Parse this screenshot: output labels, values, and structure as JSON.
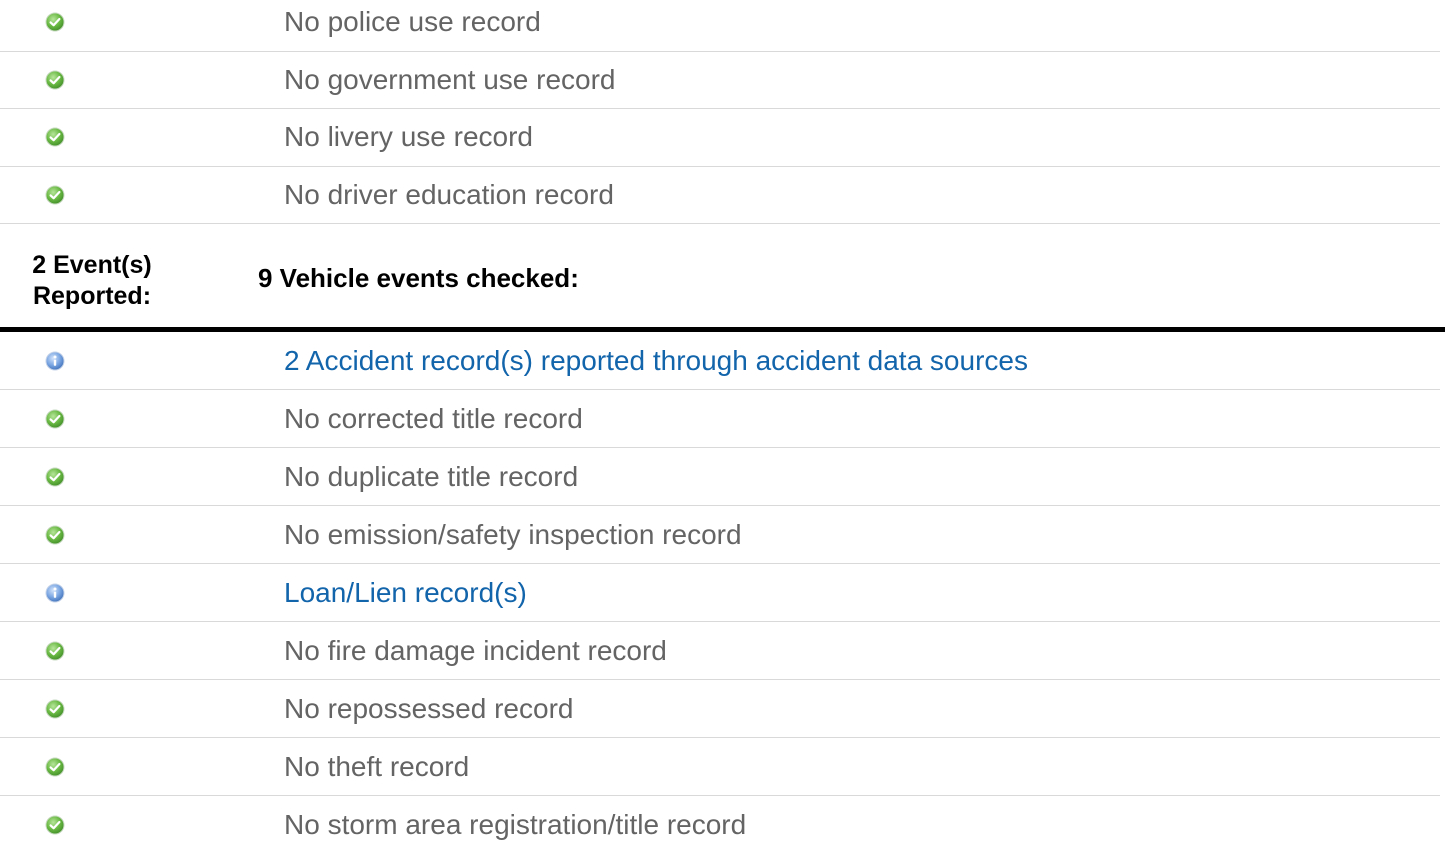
{
  "colors": {
    "ok_green": "#69b943",
    "info_blue": "#5d8fd3",
    "text_gray": "#646464",
    "link_blue": "#1264ab",
    "divider": "#d9d9d9"
  },
  "usage_checks": [
    {
      "icon": "check-icon",
      "text": "No police use record"
    },
    {
      "icon": "check-icon",
      "text": "No government use record"
    },
    {
      "icon": "check-icon",
      "text": "No livery use record"
    },
    {
      "icon": "check-icon",
      "text": "No driver education record"
    }
  ],
  "events_header": {
    "count_line1": "2 Event(s)",
    "count_line2": "Reported:",
    "checked_label": "9 Vehicle events checked:"
  },
  "event_checks": [
    {
      "icon": "info-icon",
      "text": "2 Accident record(s) reported through accident data sources",
      "link": true
    },
    {
      "icon": "check-icon",
      "text": "No corrected title record",
      "link": false
    },
    {
      "icon": "check-icon",
      "text": "No duplicate title record",
      "link": false
    },
    {
      "icon": "check-icon",
      "text": "No emission/safety inspection record",
      "link": false
    },
    {
      "icon": "info-icon",
      "text": "Loan/Lien record(s)",
      "link": true
    },
    {
      "icon": "check-icon",
      "text": "No fire damage incident record",
      "link": false
    },
    {
      "icon": "check-icon",
      "text": "No repossessed record",
      "link": false
    },
    {
      "icon": "check-icon",
      "text": "No theft record",
      "link": false
    },
    {
      "icon": "check-icon",
      "text": "No storm area registration/title record",
      "link": false
    }
  ]
}
